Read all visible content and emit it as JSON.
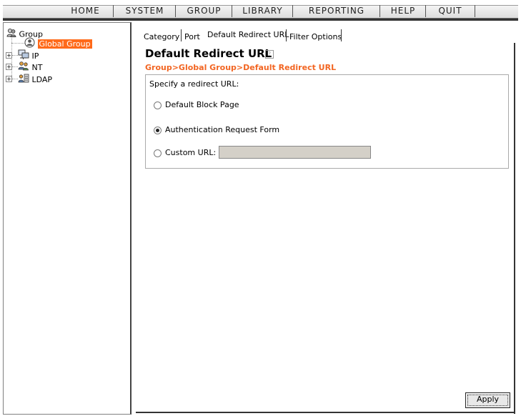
{
  "nav": {
    "items": [
      "HOME",
      "SYSTEM",
      "GROUP",
      "LIBRARY",
      "REPORTING",
      "HELP",
      "QUIT"
    ]
  },
  "tree": {
    "root_label": "Group",
    "selected_label": "Global Group",
    "children": [
      "IP",
      "NT",
      "LDAP"
    ]
  },
  "tabs": [
    "Category",
    "Port",
    "Default Redirect URL",
    "Filter Options"
  ],
  "page": {
    "title": "Default Redirect URL",
    "help_icon": "?",
    "breadcrumb": "Group>Global Group>Default Redirect URL"
  },
  "form": {
    "prompt": "Specify a redirect URL:",
    "options": [
      "Default Block Page",
      "Authentication Request Form",
      "Custom URL:"
    ],
    "selected_option": "Authentication Request Form",
    "custom_url_value": ""
  },
  "buttons": {
    "apply": "Apply"
  },
  "colors": {
    "accent": "#f26522",
    "selection": "#ff6a1a"
  }
}
